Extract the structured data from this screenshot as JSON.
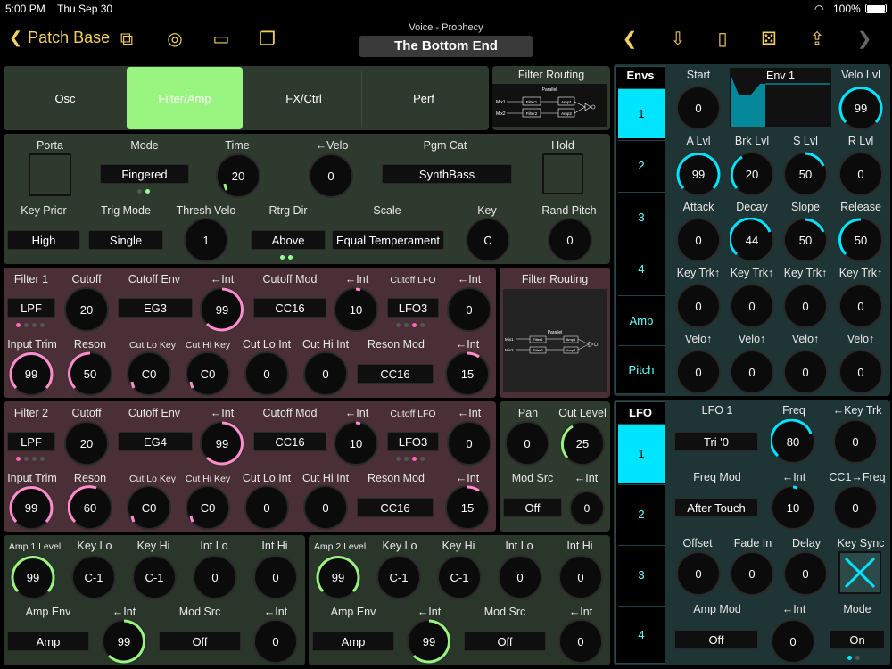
{
  "status": {
    "time": "5:00 PM",
    "date": "Thu Sep 30",
    "battery": "100%"
  },
  "nav": {
    "back_label": "Patch Base",
    "subtitle": "Voice - Prophecy",
    "title": "The Bottom End"
  },
  "tabs": [
    "Osc",
    "Filter/Amp",
    "FX/Ctrl",
    "Perf"
  ],
  "filter_routing": {
    "title": "Filter Routing",
    "mode": "Parallel",
    "nodes": [
      "Mix1",
      "Mix2",
      "Filter1",
      "Filter2",
      "Amp1",
      "Amp2"
    ]
  },
  "voice": {
    "labels": [
      "Porta",
      "Mode",
      "Time",
      "←Velo",
      "Pgm Cat",
      "Hold",
      "Key Prior",
      "Trig Mode",
      "Thresh Velo",
      "Rtrg Dir",
      "Scale",
      "Key",
      "Rand Pitch"
    ],
    "mode": "Fingered",
    "time": "20",
    "velo": "0",
    "pgm_cat": "SynthBass",
    "key_prior": "High",
    "trig_mode": "Single",
    "thresh_velo": "1",
    "rtrg_dir": "Above",
    "scale": "Equal Temperament",
    "key": "C",
    "rand_pitch": "0"
  },
  "filter1": {
    "labels": [
      "Filter 1",
      "Cutoff",
      "Cutoff Env",
      "←Int",
      "Cutoff Mod",
      "←Int",
      "Cutoff LFO",
      "←Int",
      "Input Trim",
      "Reson",
      "Cut Lo Key",
      "Cut Hi Key",
      "Cut Lo Int",
      "Cut Hi Int",
      "Reson Mod",
      "←Int"
    ],
    "type": "LPF",
    "cutoff": "20",
    "env": "EG3",
    "env_int": "99",
    "mod": "CC16",
    "mod_int": "10",
    "lfo": "LFO3",
    "lfo_int": "0",
    "input_trim": "99",
    "reson": "50",
    "lo_key": "C0",
    "hi_key": "C0",
    "lo_int": "0",
    "hi_int": "0",
    "reson_mod": "CC16",
    "reson_int": "15"
  },
  "filter2": {
    "labels": [
      "Filter 2",
      "Cutoff",
      "Cutoff Env",
      "←Int",
      "Cutoff Mod",
      "←Int",
      "Cutoff LFO",
      "←Int",
      "Input Trim",
      "Reson",
      "Cut Lo Key",
      "Cut Hi Key",
      "Cut Lo Int",
      "Cut Hi Int",
      "Reson Mod",
      "←Int"
    ],
    "type": "LPF",
    "cutoff": "20",
    "env": "EG4",
    "env_int": "99",
    "mod": "CC16",
    "mod_int": "10",
    "lfo": "LFO3",
    "lfo_int": "0",
    "input_trim": "99",
    "reson": "60",
    "lo_key": "C0",
    "hi_key": "C0",
    "lo_int": "0",
    "hi_int": "0",
    "reson_mod": "CC16",
    "reson_int": "15"
  },
  "output": {
    "labels": [
      "Pan",
      "Out Level",
      "Mod Src",
      "←Int"
    ],
    "pan": "0",
    "level": "25",
    "mod_src": "Off",
    "int": "0"
  },
  "amp1": {
    "labels": [
      "Amp 1 Level",
      "Key Lo",
      "Key Hi",
      "Int Lo",
      "Int Hi",
      "Amp Env",
      "←Int",
      "Mod Src",
      "←Int"
    ],
    "level": "99",
    "key_lo": "C-1",
    "key_hi": "C-1",
    "int_lo": "0",
    "int_hi": "0",
    "env": "Amp",
    "env_int": "99",
    "mod_src": "Off",
    "mod_int": "0"
  },
  "amp2": {
    "labels": [
      "Amp 2 Level",
      "Key Lo",
      "Key Hi",
      "Int Lo",
      "Int Hi",
      "Amp Env",
      "←Int",
      "Mod Src",
      "←Int"
    ],
    "level": "99",
    "key_lo": "C-1",
    "key_hi": "C-1",
    "int_lo": "0",
    "int_hi": "0",
    "env": "Amp",
    "env_int": "99",
    "mod_src": "Off",
    "mod_int": "0"
  },
  "envs": {
    "title": "Envs",
    "tabs": [
      "1",
      "2",
      "3",
      "4",
      "Amp",
      "Pitch"
    ],
    "graph_title": "Env 1",
    "labels": [
      "Start",
      "Velo Lvl",
      "A Lvl",
      "Brk Lvl",
      "S Lvl",
      "R Lvl",
      "Attack",
      "Decay",
      "Slope",
      "Release",
      "Key Trk↑",
      "Key Trk↑",
      "Key Trk↑",
      "Key Trk↑",
      "Velo↑",
      "Velo↑",
      "Velo↑",
      "Velo↑"
    ],
    "values": [
      "0",
      "99",
      "99",
      "20",
      "50",
      "0",
      "0",
      "44",
      "50",
      "50",
      "0",
      "0",
      "0",
      "0",
      "0",
      "0",
      "0",
      "0"
    ]
  },
  "lfo": {
    "title": "LFO",
    "tabs": [
      "1",
      "2",
      "3",
      "4"
    ],
    "labels": [
      "LFO 1",
      "Freq",
      "←Key Trk",
      "Freq Mod",
      "←Int",
      "CC1→Freq",
      "Offset",
      "Fade In",
      "Delay",
      "Key Sync",
      "Amp Mod",
      "←Int",
      "Mode"
    ],
    "wave": "Tri '0",
    "freq": "80",
    "key_trk": "0",
    "freq_mod": "After Touch",
    "int": "10",
    "cc1": "0",
    "offset": "0",
    "fade": "0",
    "delay": "0",
    "amp_mod": "Off",
    "amp_int": "0",
    "mode": "On"
  },
  "colors": {
    "accent_green": "#99f57f",
    "filter_bg": "#4a2f37",
    "voice_bg": "#2e3a2e",
    "amp_bg": "#2a362a",
    "env_bg": "#1f3434",
    "cyan": "#00e5ff",
    "pink": "#ff8ccc"
  }
}
